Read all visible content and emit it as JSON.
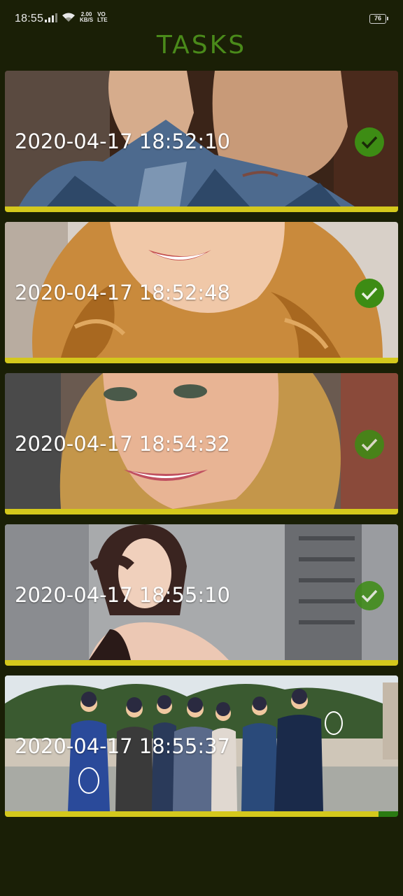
{
  "status_bar": {
    "time": "18:55",
    "net_speed_value": "2.00",
    "net_speed_unit": "KB/S",
    "volte_top": "VO",
    "volte_bottom": "LTE",
    "battery": "76",
    "icons": [
      "signal-icon",
      "wifi-icon",
      "battery-icon"
    ]
  },
  "header": {
    "title": "TASKS",
    "title_color": "#4a8a1a"
  },
  "tasks": [
    {
      "timestamp": "2020-04-17 18:52:10",
      "completed": true,
      "progress": 1.0,
      "thumbnail": "man in blue plaid shirt"
    },
    {
      "timestamp": "2020-04-17 18:52:48",
      "completed": true,
      "progress": 1.0,
      "thumbnail": "woman with red curly hair"
    },
    {
      "timestamp": "2020-04-17 18:54:32",
      "completed": true,
      "progress": 1.0,
      "thumbnail": "blonde woman smiling"
    },
    {
      "timestamp": "2020-04-17 18:55:10",
      "completed": true,
      "progress": 1.0,
      "thumbnail": "woman with dark hair outdoors"
    },
    {
      "timestamp": "2020-04-17 18:55:37",
      "completed": false,
      "progress": 0.95,
      "thumbnail": "group of seven men outdoors"
    }
  ],
  "colors": {
    "background": "#1a1f06",
    "progress_bar": "#d4c81c",
    "progress_remaining": "#2a7a12",
    "check_badge": "#3d8c14"
  }
}
